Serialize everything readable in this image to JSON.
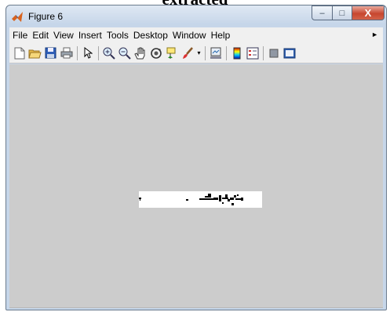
{
  "caption": "extracted",
  "window": {
    "title": "Figure 6",
    "controls": {
      "minimize": "–",
      "maximize": "□",
      "close": "X"
    }
  },
  "menubar": {
    "items": [
      "File",
      "Edit",
      "View",
      "Insert",
      "Tools",
      "Desktop",
      "Window",
      "Help"
    ],
    "overflow_icon": "chevron-right-icon"
  },
  "toolbar": {
    "buttons": [
      {
        "name": "new-figure-icon"
      },
      {
        "name": "open-file-icon"
      },
      {
        "name": "save-figure-icon"
      },
      {
        "name": "print-figure-icon"
      },
      {
        "name": "separator"
      },
      {
        "name": "edit-plot-arrow-icon"
      },
      {
        "name": "separator"
      },
      {
        "name": "zoom-in-icon"
      },
      {
        "name": "zoom-out-icon"
      },
      {
        "name": "pan-hand-icon"
      },
      {
        "name": "rotate-3d-icon"
      },
      {
        "name": "data-cursor-icon"
      },
      {
        "name": "brush-icon"
      },
      {
        "name": "brush-dropdown-icon"
      },
      {
        "name": "separator"
      },
      {
        "name": "link-plot-icon"
      },
      {
        "name": "separator"
      },
      {
        "name": "colorbar-icon"
      },
      {
        "name": "legend-icon"
      },
      {
        "name": "separator"
      },
      {
        "name": "hide-plot-tools-icon"
      },
      {
        "name": "show-plot-tools-icon"
      }
    ]
  },
  "colors": {
    "figure_background": "#cccccc",
    "image_background": "#ffffff",
    "image_foreground": "#000000"
  }
}
